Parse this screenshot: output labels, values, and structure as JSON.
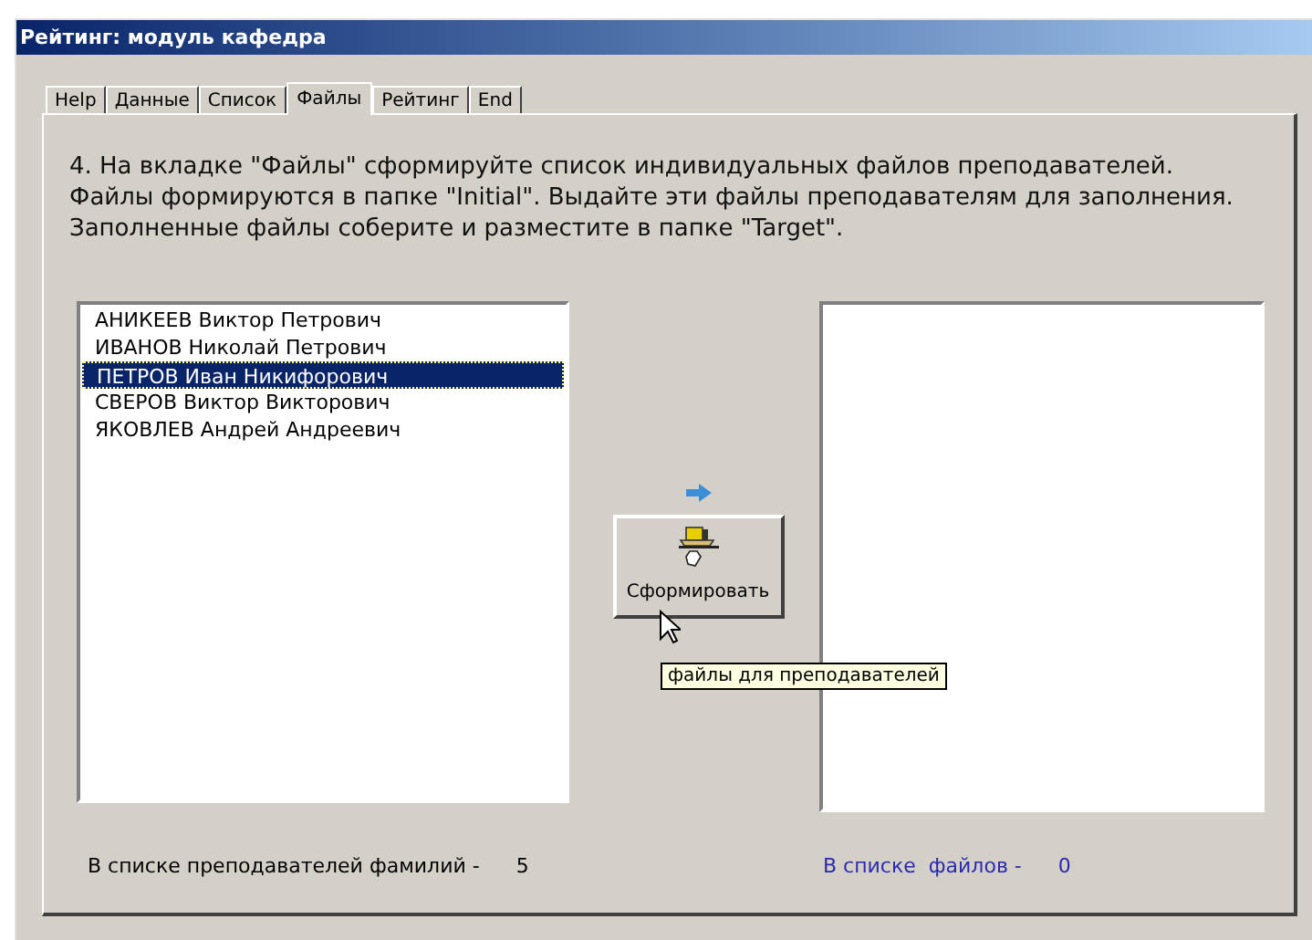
{
  "window": {
    "title": "Рейтинг: модуль кафедра"
  },
  "tabs": [
    {
      "label": "Help",
      "selected": false
    },
    {
      "label": "Данные",
      "selected": false
    },
    {
      "label": "Список",
      "selected": false
    },
    {
      "label": "Файлы",
      "selected": true
    },
    {
      "label": "Рейтинг",
      "selected": false
    },
    {
      "label": "End",
      "selected": false
    }
  ],
  "instructions": "4. На вкладке \"Файлы\" сформируйте список индивидуальных файлов преподавателей. Файлы формируются в папке \"Initial\". Выдайте эти файлы преподавателям для заполнения. Заполненные файлы соберите и разместите в папке \"Target\".",
  "teachers": [
    {
      "name": "АНИКЕЕВ Виктор Петрович",
      "selected": false
    },
    {
      "name": "ИВАНОВ Николай Петрович",
      "selected": false
    },
    {
      "name": "ПЕТРОВ Иван Никифорович",
      "selected": true
    },
    {
      "name": "СВЕРОВ Виктор Викторович",
      "selected": false
    },
    {
      "name": "ЯКОВЛЕВ Андрей Андреевич",
      "selected": false
    }
  ],
  "generate_button": {
    "label": "Сформировать",
    "tooltip": "файлы для преподавателей"
  },
  "teacher_count": {
    "label": "В списке преподавателей фамилий -",
    "value": "5"
  },
  "file_count": {
    "label": "В списке  файлов -",
    "value": "0"
  }
}
